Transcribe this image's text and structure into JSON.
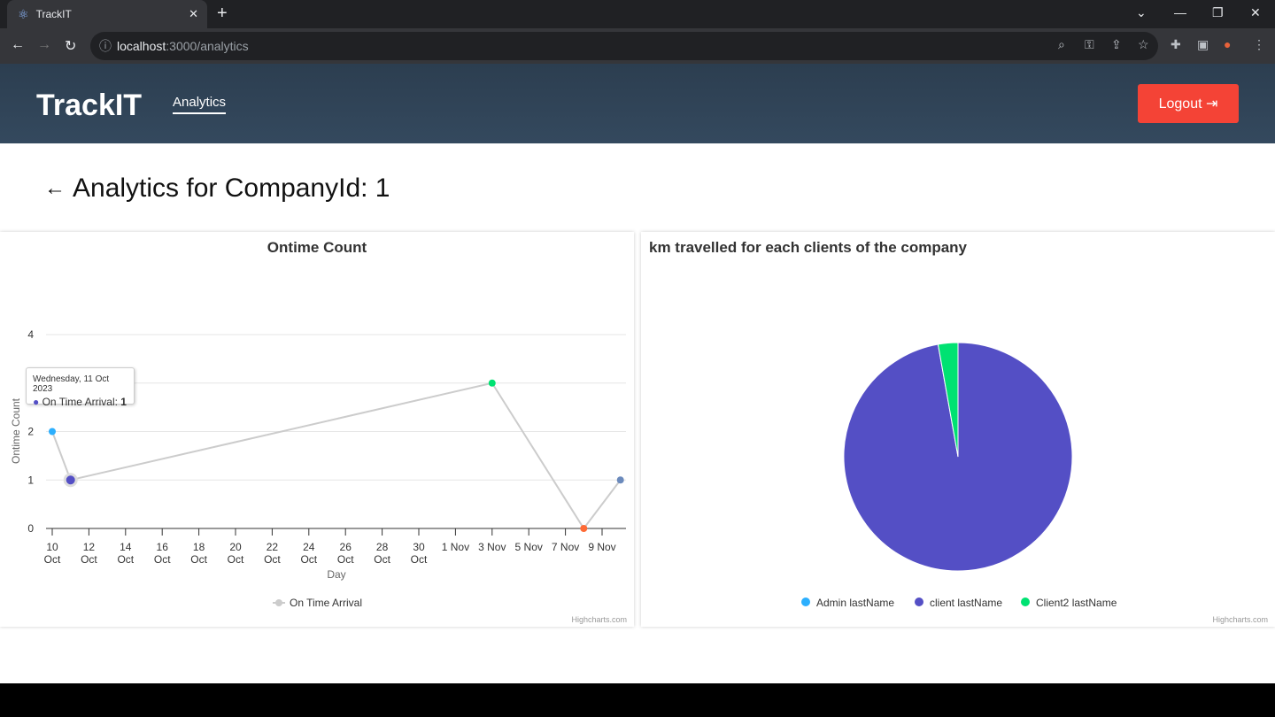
{
  "browser": {
    "tab_title": "TrackIT",
    "url_host": "localhost",
    "url_path": ":3000/analytics"
  },
  "app": {
    "brand": "TrackIT",
    "nav_analytics": "Analytics",
    "logout": "Logout"
  },
  "page": {
    "back_icon": "arrow-left-icon",
    "title": "Analytics for CompanyId: 1"
  },
  "chart_data": [
    {
      "type": "line",
      "title": "Ontime Count",
      "xlabel": "Day",
      "ylabel": "Ontime Count",
      "ylim": [
        0,
        4
      ],
      "yticks": [
        "0",
        "1",
        "2",
        "3",
        "4"
      ],
      "xticks": [
        "10 Oct",
        "12 Oct",
        "14 Oct",
        "16 Oct",
        "18 Oct",
        "20 Oct",
        "22 Oct",
        "24 Oct",
        "26 Oct",
        "28 Oct",
        "30 Oct",
        "1 Nov",
        "3 Nov",
        "5 Nov",
        "7 Nov",
        "9 Nov"
      ],
      "series": [
        {
          "name": "On Time Arrival",
          "points": [
            {
              "x": "2023-10-10",
              "y": 2,
              "color": "#2caffe"
            },
            {
              "x": "2023-10-11",
              "y": 1,
              "color": "#544fc5"
            },
            {
              "x": "2023-11-03",
              "y": 3,
              "color": "#00e272"
            },
            {
              "x": "2023-11-08",
              "y": 0,
              "color": "#fe6a35"
            },
            {
              "x": "2023-11-10",
              "y": 1,
              "color": "#6b8abc"
            }
          ]
        }
      ],
      "legend": "bottom",
      "grid": true,
      "credit": "Highcharts.com",
      "tooltip": {
        "date": "Wednesday, 11 Oct 2023",
        "label": "On Time Arrival: ",
        "value": "1"
      }
    },
    {
      "type": "pie",
      "title": "km travelled for each clients of the company",
      "slices": [
        {
          "name": "Admin lastName",
          "value": 0,
          "color": "#2caffe"
        },
        {
          "name": "client lastName",
          "value": 97.2,
          "color": "#544fc5"
        },
        {
          "name": "Client2 lastName",
          "value": 2.8,
          "color": "#00e272"
        }
      ],
      "legend": "bottom",
      "credit": "Highcharts.com"
    }
  ]
}
